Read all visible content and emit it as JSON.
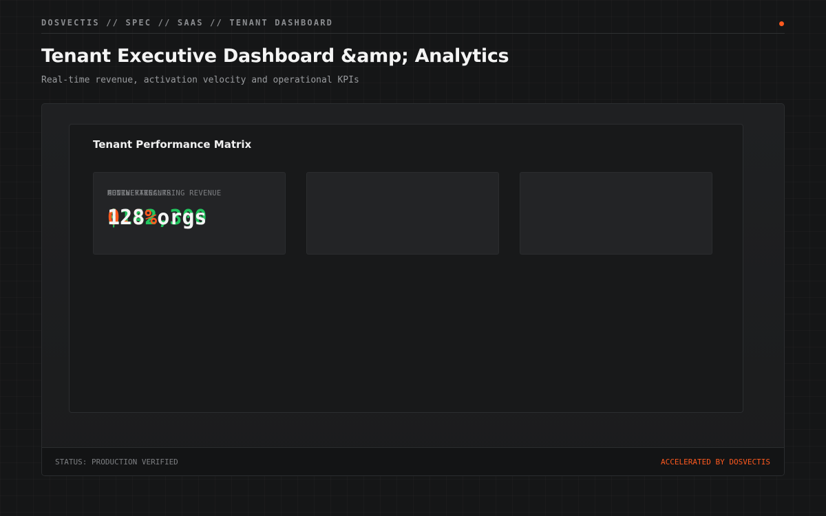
{
  "header": {
    "breadcrumb": "DOSVECTIS // SPEC // SAAS // TENANT DASHBOARD",
    "title": "Tenant Executive Dashboard &amp; Analytics",
    "subtitle": "Real-time revenue, activation velocity and operational KPIs"
  },
  "matrix": {
    "title": "Tenant Performance Matrix",
    "kpis": [
      {
        "label": "MONTHLY RECURRING REVENUE",
        "value": "$142,300",
        "color": "#22c55e"
      },
      {
        "label": "ACTIVE TENANTS",
        "value": "128 orgs",
        "color": "#f4f4f4"
      },
      {
        "label": "CHURN RATE",
        "value": "0.8%",
        "color": "#ff5a1f"
      }
    ]
  },
  "footer": {
    "status": "STATUS: PRODUCTION VERIFIED",
    "credit": "ACCELERATED BY DOSVECTIS"
  },
  "colors": {
    "accent": "#ff5a1f",
    "positive": "#22c55e"
  }
}
